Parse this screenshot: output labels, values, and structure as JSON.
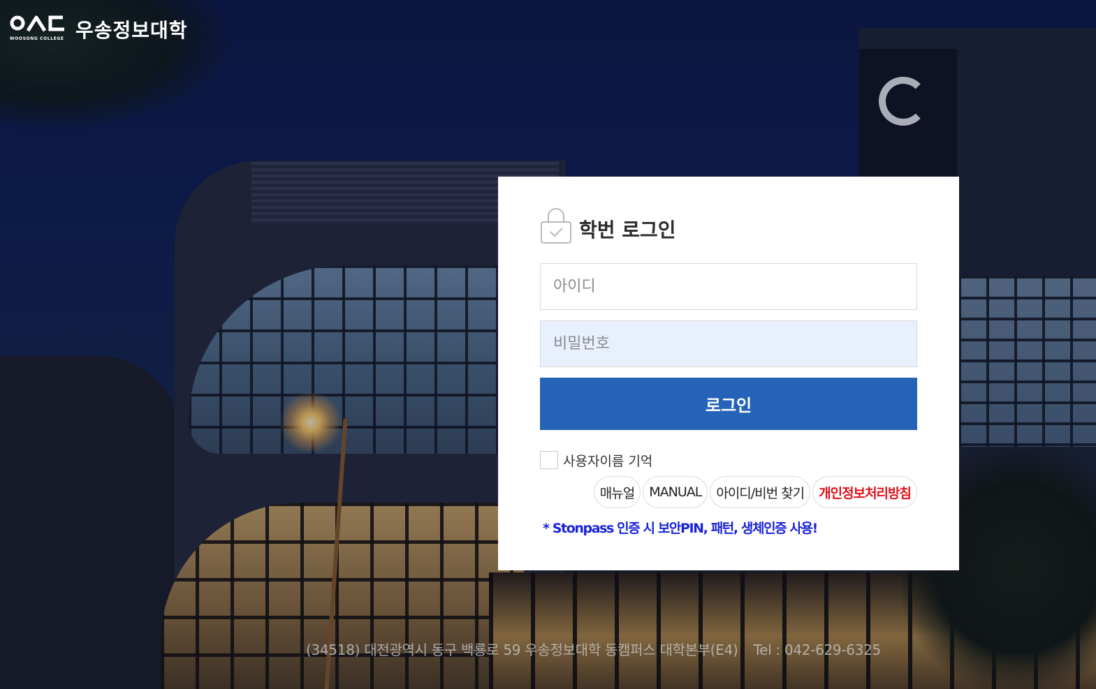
{
  "brand": {
    "symbol_text": "ㅇㅅㄷ",
    "sub_text": "WOOSONG COLLEGE",
    "name": "우송정보대학"
  },
  "login": {
    "title": "학번 로그인",
    "id_placeholder": "아이디",
    "password_placeholder": "비밀번호",
    "login_button": "로그인",
    "remember_label": "사용자이름 기억",
    "links": {
      "manual_ko": "매뉴얼",
      "manual_en": "MANUAL",
      "find_account": "아이디/비번 찾기",
      "privacy_policy": "개인정보처리방침"
    },
    "notice": "* Stonpass 인증 시 보안PIN, 패턴, 생체인증 사용!"
  },
  "footer": {
    "address": "(34518) 대전광역시 동구 백룡로 59 우송정보대학 동캠퍼스 대학본부(E4)",
    "tel": "Tel : 042-629-6325"
  },
  "colors": {
    "login_button": "#2563b8",
    "password_field_bg": "#e9f0fd",
    "privacy_link": "#e0121b",
    "notice_text": "#1a23d6"
  },
  "icons": {
    "title_icon": "lock-check-icon"
  }
}
